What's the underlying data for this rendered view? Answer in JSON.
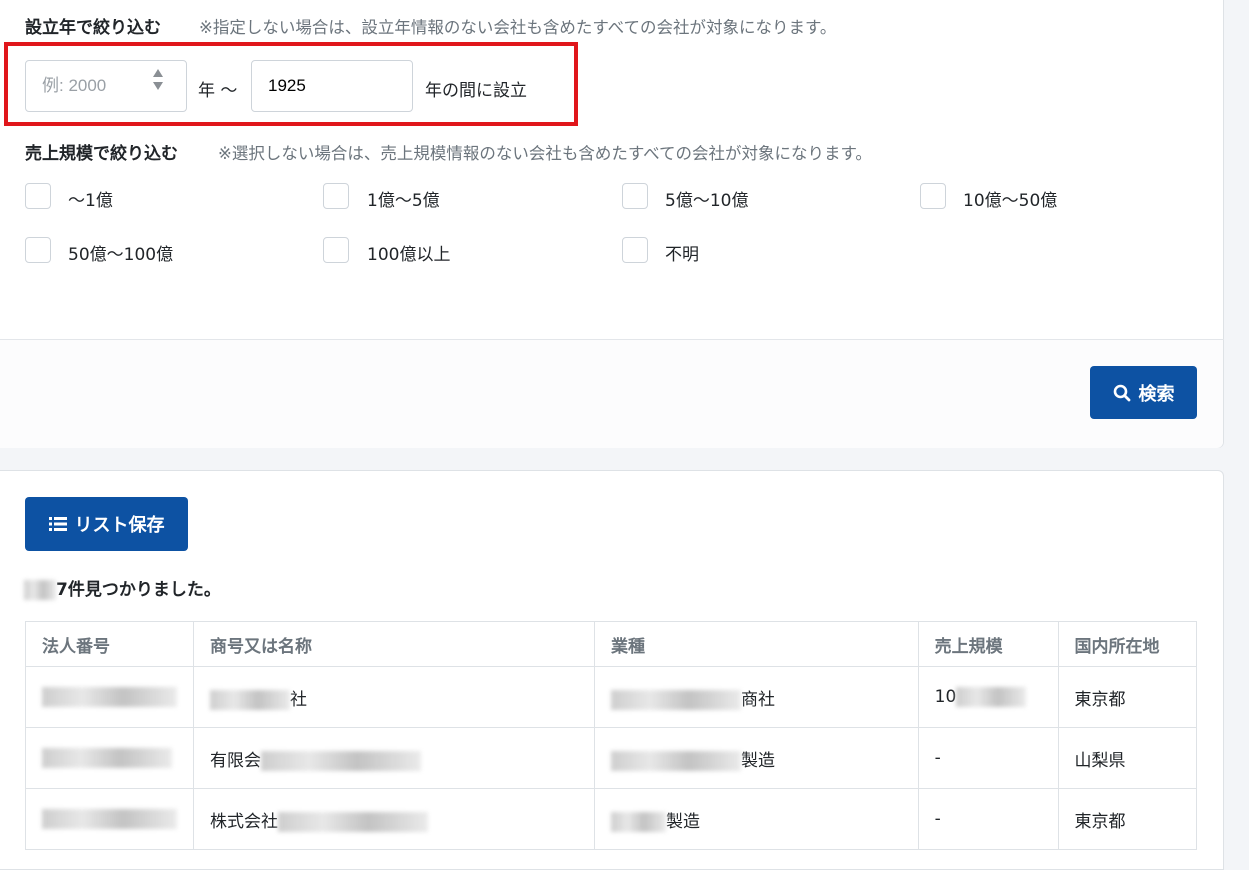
{
  "founded_filter": {
    "label": "設立年で絞り込む",
    "note": "※指定しない場合は、設立年情報のない会社も含めたすべての会社が対象になります。",
    "from_placeholder": "例: 2000",
    "from_value": "",
    "separator": "年 〜",
    "to_value": "1925",
    "suffix": "年の間に設立"
  },
  "revenue_filter": {
    "label": "売上規模で絞り込む",
    "note": "※選択しない場合は、売上規模情報のない会社も含めたすべての会社が対象になります。",
    "options": [
      {
        "label": "〜1億",
        "checked": false
      },
      {
        "label": "1億〜5億",
        "checked": false
      },
      {
        "label": "5億〜10億",
        "checked": false
      },
      {
        "label": "10億〜50億",
        "checked": false
      },
      {
        "label": "50億〜100億",
        "checked": false
      },
      {
        "label": "100億以上",
        "checked": false
      },
      {
        "label": "不明",
        "checked": false
      }
    ]
  },
  "search_button": {
    "label": "検索",
    "icon": "search-icon"
  },
  "save_list_button": {
    "label": "リスト保存",
    "icon": "list-icon"
  },
  "results": {
    "count_text": "7件見つかりました。",
    "columns": [
      "法人番号",
      "商号又は名称",
      "業種",
      "売上規模",
      "国内所在地"
    ],
    "rows": [
      {
        "corp_no": "",
        "name": "社",
        "industry": "商社",
        "revenue": "10",
        "location": "東京都"
      },
      {
        "corp_no": "",
        "name": "有限会",
        "industry": "製造",
        "revenue": "-",
        "location": "山梨県"
      },
      {
        "corp_no": "",
        "name": "株式会社",
        "industry": "製造",
        "revenue": "-",
        "location": "東京都"
      }
    ]
  },
  "colors": {
    "primary": "#0d52a3",
    "highlight": "#e0161b"
  }
}
